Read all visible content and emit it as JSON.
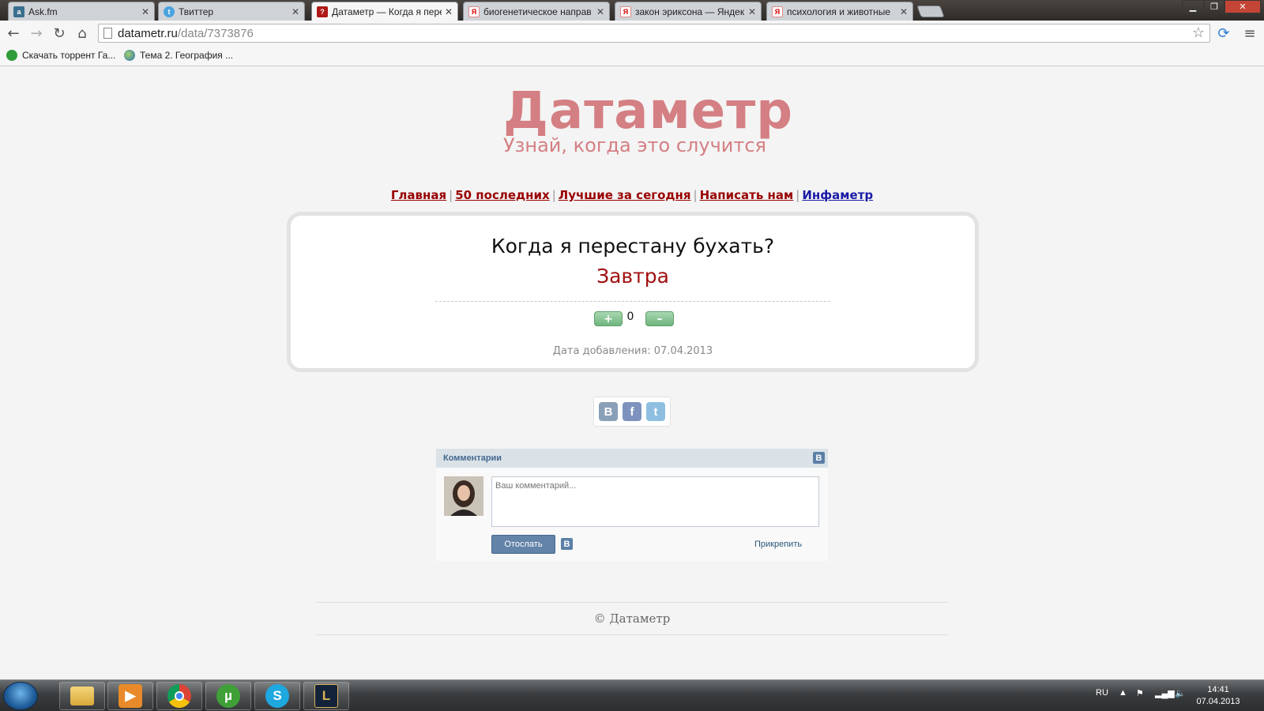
{
  "browser": {
    "tabs": [
      {
        "title": "Ask.fm",
        "icon": "askfm-favicon"
      },
      {
        "title": "Твиттер",
        "icon": "twitter-favicon"
      },
      {
        "title": "Датаметр — Когда я пере",
        "icon": "question-favicon"
      },
      {
        "title": "биогенетическое направ",
        "icon": "yandex-favicon"
      },
      {
        "title": "закон эриксона — Яндек",
        "icon": "yandex-favicon"
      },
      {
        "title": "психология и животные",
        "icon": "yandex-favicon"
      }
    ],
    "url_host": "datametr.ru",
    "url_path": "/data/7373876",
    "bookmarks": [
      {
        "label": "Скачать торрент Га...",
        "icon": "torrent-favicon"
      },
      {
        "label": "Тема 2. География ...",
        "icon": "globe-favicon"
      }
    ]
  },
  "site": {
    "logo": "Датаметр",
    "slogan": "Узнай, когда это случится",
    "nav": [
      "Главная",
      "50 последних",
      "Лучшие за сегодня",
      "Написать нам",
      "Инфаметр"
    ],
    "nav_separator": "|",
    "accent_color": "#990000",
    "logo_color": "#d47f83"
  },
  "card": {
    "question": "Когда я перестану бухать?",
    "answer": "Завтра",
    "upvote_label": "+",
    "downvote_label": "–",
    "score": "0",
    "date_added": "Дата добавления: 07.04.2013"
  },
  "share": {
    "icons": [
      "vk-share-icon",
      "facebook-share-icon",
      "twitter-share-icon"
    ],
    "vk_letter": "B",
    "fb_letter": "f",
    "tw_letter": "t"
  },
  "comments": {
    "header": "Комментарии",
    "vk_badge": "B",
    "placeholder": "Ваш комментарий...",
    "send_label": "Отослать",
    "attach_label": "Прикрепить"
  },
  "footer": {
    "copyright": "© Датаметр"
  },
  "taskbar": {
    "language": "RU",
    "time": "14:41",
    "date": "07.04.2013",
    "apps": [
      "explorer",
      "media-player",
      "chrome",
      "utorrent",
      "skype",
      "league-of-legends"
    ]
  }
}
